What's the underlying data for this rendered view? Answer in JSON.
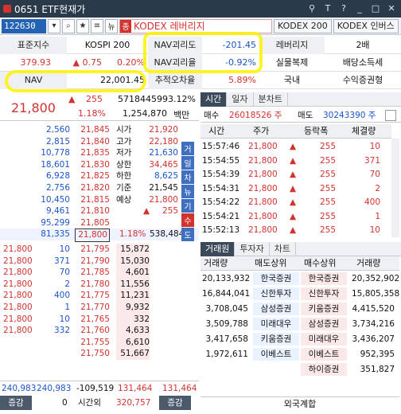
{
  "title": {
    "text": "0651 ETF현재가"
  },
  "toolbar": {
    "code": "122630",
    "name": "KODEX 레버리지",
    "name_tag": "종",
    "btn1": "KODEX 200",
    "btn2": "KODEX 인버스"
  },
  "info": {
    "r1": [
      "표준지수",
      "KOSPI 200",
      "NAV괴리도",
      "-201.45",
      "레버리지",
      "2배"
    ],
    "r2": {
      "price": "379.93",
      "change": "0.75",
      "pct": "0.20%",
      "label": "NAV괴리율",
      "value": "-0.92%",
      "type": "실물복제",
      "div": "배당소득세"
    },
    "r3": {
      "label": "NAV",
      "value": "22,001.45",
      "err_label": "추적오차율",
      "err": "5.89%",
      "domestic": "국내",
      "benefit": "수익증권형"
    }
  },
  "price": {
    "current": "21,800",
    "change": "255",
    "volume": "57184459",
    "vol_pct": "93.12%",
    "pct": "1.18%",
    "amount": "1,254,870",
    "amount_unit": "백만"
  },
  "orderbook": {
    "ask": [
      [
        "2,560",
        "21,845"
      ],
      [
        "2,815",
        "21,840"
      ],
      [
        "10,778",
        "21,835"
      ],
      [
        "18,601",
        "21,830"
      ],
      [
        "6,928",
        "21,825"
      ],
      [
        "2,756",
        "21,820"
      ],
      [
        "10,450",
        "21,815"
      ],
      [
        "9,461",
        "21,810"
      ],
      [
        "95,299",
        "21,805"
      ],
      [
        "81,335",
        "21,800"
      ]
    ],
    "info_labels": [
      "시가",
      "고가",
      "저가",
      "상한",
      "하한",
      "기준",
      "예상"
    ],
    "info_values": [
      "21,920",
      "22,180",
      "21,630",
      "34,465",
      "8,625",
      "21,545",
      "21,800"
    ],
    "exp_change": "255",
    "mid": {
      "pct": "1.18%",
      "vol": "538,484"
    },
    "bid": [
      [
        "21,800",
        "10",
        "21,795",
        "15,872"
      ],
      [
        "21,800",
        "371",
        "21,790",
        "15,030"
      ],
      [
        "21,800",
        "70",
        "21,785",
        "4,601"
      ],
      [
        "21,800",
        "2",
        "21,780",
        "11,556"
      ],
      [
        "21,800",
        "400",
        "21,775",
        "11,231"
      ],
      [
        "21,800",
        "1",
        "21,770",
        "9,932"
      ],
      [
        "21,800",
        "10",
        "21,765",
        "332"
      ],
      [
        "21,800",
        "332",
        "21,760",
        "4,633"
      ],
      [
        "",
        "",
        "21,755",
        "6,610"
      ],
      [
        "",
        "",
        "21,750",
        "51,667"
      ]
    ],
    "side_buttons": [
      "거",
      "일",
      "차",
      "뉴",
      "기",
      "수",
      "도"
    ]
  },
  "totals": {
    "ask_total": "240,983",
    "bid_total": "240,983",
    "diff": "-109,519",
    "v1": "131,464",
    "v2": "131,464",
    "lbl1": "증감",
    "lbl2": "0",
    "lbl3": "시간외",
    "v3": "320,757",
    "lbl4": "증감"
  },
  "tabs1": [
    "시간",
    "일자",
    "분차트"
  ],
  "trade_summary": {
    "buy_label": "매수",
    "buy_value": "26018526 주",
    "sell_label": "매도",
    "sell_value": "30243390 주"
  },
  "ticks": {
    "headers": [
      "시간",
      "주가",
      "등락폭",
      "체결량"
    ],
    "rows": [
      [
        "15:57:46",
        "21,800",
        "255",
        "10"
      ],
      [
        "15:54:55",
        "21,800",
        "255",
        "371"
      ],
      [
        "15:54:39",
        "21,800",
        "255",
        "70"
      ],
      [
        "15:54:31",
        "21,800",
        "255",
        "2"
      ],
      [
        "15:54:22",
        "21,800",
        "255",
        "400"
      ],
      [
        "15:54:21",
        "21,800",
        "255",
        "1"
      ],
      [
        "15:52:13",
        "21,800",
        "255",
        "10"
      ]
    ]
  },
  "tabs2": [
    "거래원",
    "투자자",
    "차트"
  ],
  "broker": {
    "headers": [
      "거래량",
      "매도상위",
      "매수상위",
      "거래량"
    ],
    "rows": [
      [
        "20,133,932",
        "한국증권",
        "한국증권",
        "20,352,902"
      ],
      [
        "16,844,041",
        "신한투자",
        "신한투자",
        "15,805,358"
      ],
      [
        "3,708,045",
        "삼성증권",
        "키움증권",
        "4,415,520"
      ],
      [
        "3,509,788",
        "미래대우",
        "삼성증권",
        "3,734,216"
      ],
      [
        "3,417,658",
        "키움증권",
        "미래대우",
        "3,436,207"
      ],
      [
        "1,972,611",
        "이베스트",
        "이베스트",
        "952,395"
      ],
      [
        "",
        "",
        "하이증권",
        "351,827"
      ]
    ],
    "foreign": "외국계합"
  }
}
